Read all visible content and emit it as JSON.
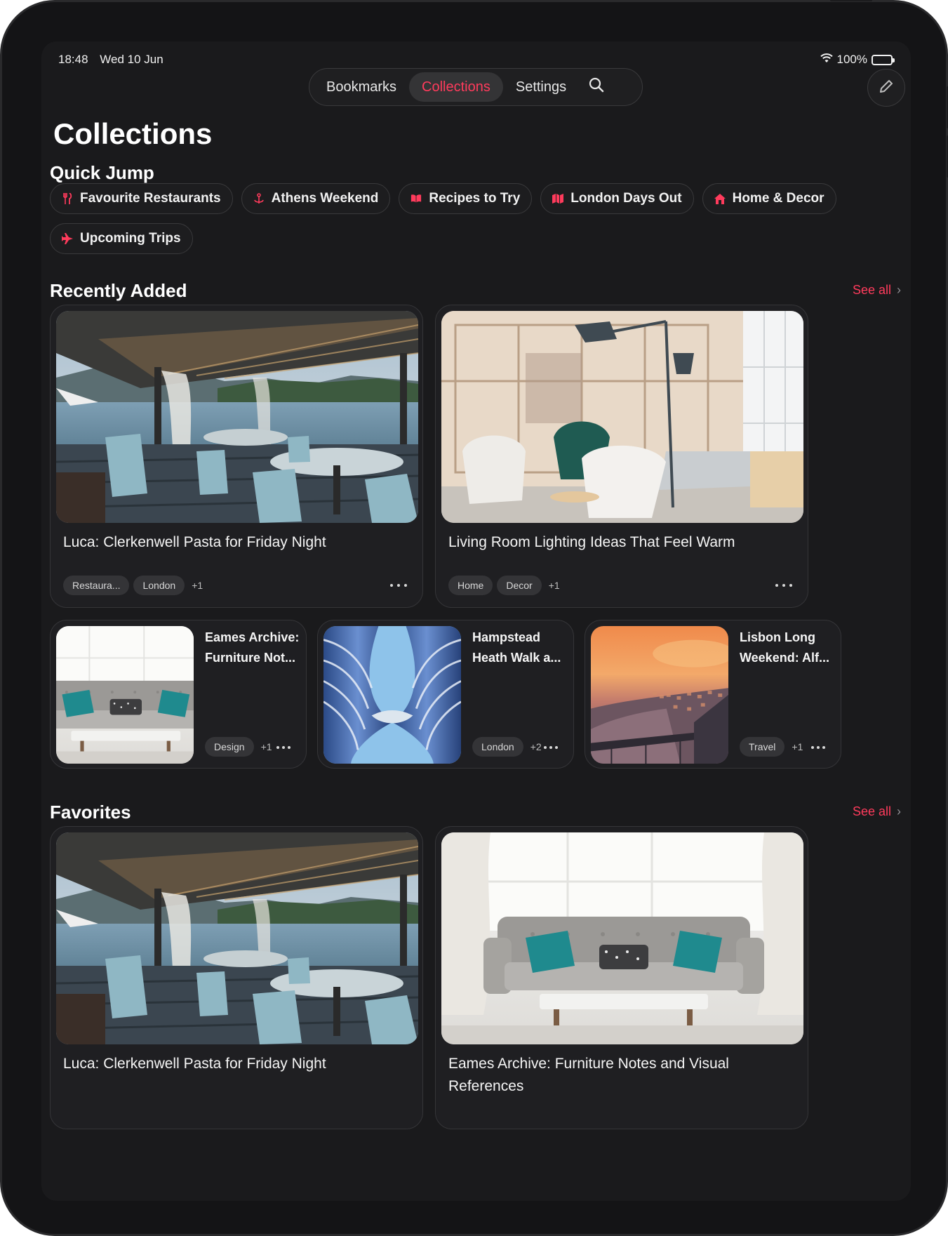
{
  "status": {
    "time": "18:48",
    "date": "Wed 10 Jun",
    "battery": "100%"
  },
  "nav": {
    "tabs": [
      {
        "label": "Bookmarks"
      },
      {
        "label": "Collections"
      },
      {
        "label": "Settings"
      }
    ],
    "active_tab": "Collections"
  },
  "page_title": "Collections",
  "quick_jump": {
    "title": "Quick Jump",
    "chips": [
      {
        "label": "Favourite Restaurants",
        "icon": "fork-knife-icon"
      },
      {
        "label": "Athens Weekend",
        "icon": "anchor-icon"
      },
      {
        "label": "Recipes to Try",
        "icon": "open-book-icon"
      },
      {
        "label": "London Days Out",
        "icon": "map-icon"
      },
      {
        "label": "Home & Decor",
        "icon": "house-icon"
      },
      {
        "label": "Upcoming Trips",
        "icon": "airplane-icon"
      }
    ]
  },
  "recently_added": {
    "title": "Recently Added",
    "see_all": "See all",
    "large_cards": [
      {
        "title": "Luca: Clerkenwell Pasta for Friday Night",
        "tags": [
          "Restaura...",
          "London"
        ],
        "more": "+1",
        "image": "restaurant-terrace"
      },
      {
        "title": "Living Room Lighting Ideas That Feel Warm",
        "tags": [
          "Home",
          "Decor"
        ],
        "more": "+1",
        "image": "living-room-lamp"
      }
    ],
    "small_cards": [
      {
        "title_line1": "Eames Archive:",
        "title_line2": "Furniture Not...",
        "tags": [
          "Design"
        ],
        "more": "+1",
        "image": "grey-sofa"
      },
      {
        "title_line1": "Hampstead",
        "title_line2": "Heath Walk a...",
        "tags": [
          "London"
        ],
        "more": "+2",
        "image": "curved-building"
      },
      {
        "title_line1": "Lisbon Long",
        "title_line2": "Weekend: Alf...",
        "tags": [
          "Travel"
        ],
        "more": "+1",
        "image": "sunset-city"
      }
    ]
  },
  "favorites": {
    "title": "Favorites",
    "see_all": "See all",
    "cards": [
      {
        "title": "Luca: Clerkenwell Pasta for Friday Night",
        "image": "restaurant-terrace"
      },
      {
        "title": "Eames Archive: Furniture Notes and Visual References",
        "image": "grey-sofa"
      }
    ]
  },
  "colors": {
    "accent": "#ff3b5c",
    "background": "#1a1a1c",
    "card": "#1f1f22"
  }
}
